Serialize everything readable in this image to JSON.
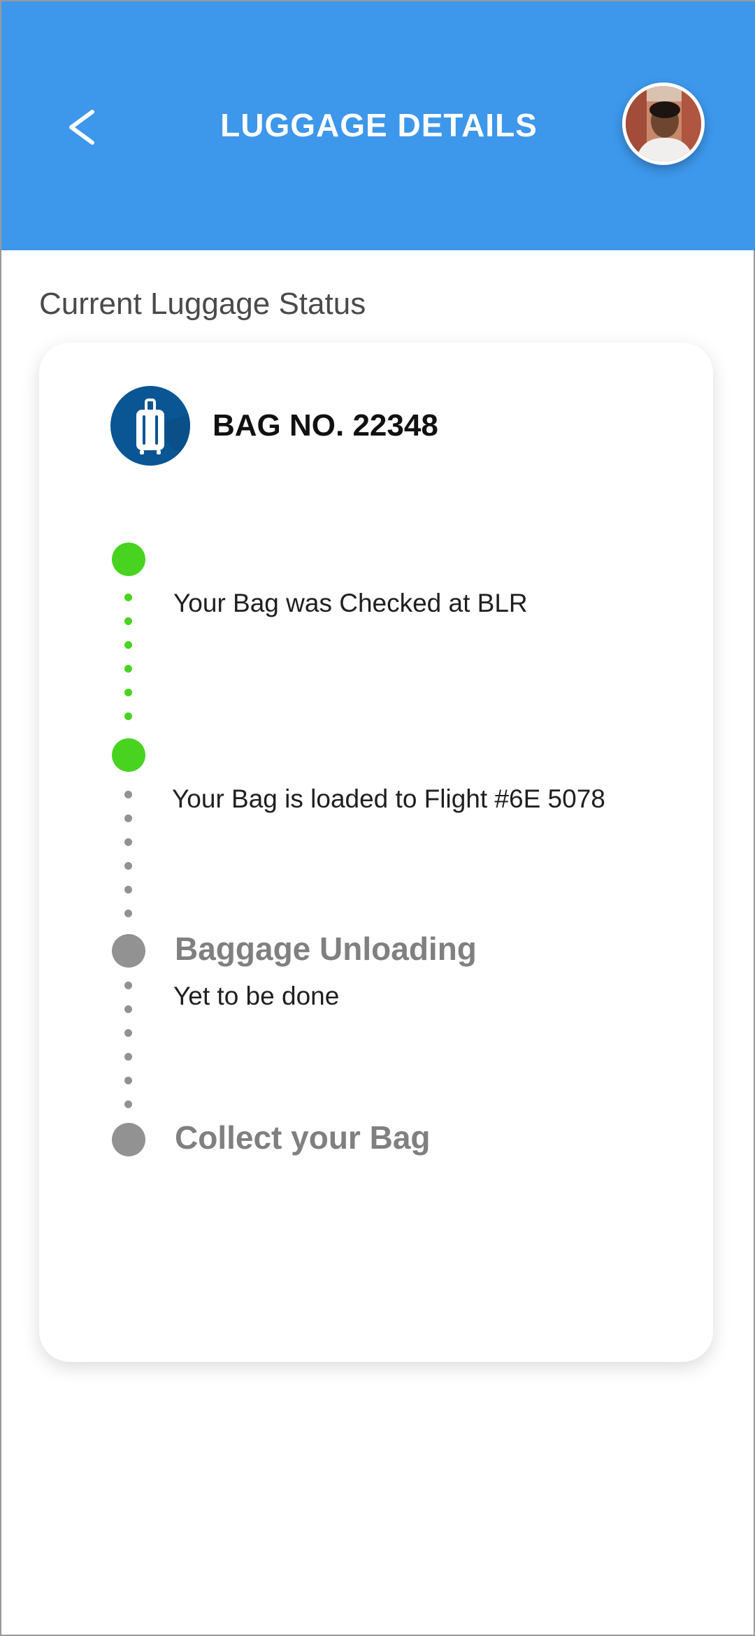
{
  "header": {
    "title": "LUGGAGE DETAILS",
    "background_color": "#3d97ea",
    "back_icon": "chevron-left-icon",
    "avatar": "user-avatar"
  },
  "section": {
    "title": "Current Luggage Status"
  },
  "bag": {
    "icon": "suitcase-icon",
    "title": "BAG NO.  22348"
  },
  "timeline": {
    "steps": [
      {
        "status": "done",
        "color": "#48d321",
        "title": "",
        "text": "Your Bag was Checked at BLR"
      },
      {
        "status": "done",
        "color": "#48d321",
        "title": "",
        "text": "Your Bag is loaded to Flight #6E 5078"
      },
      {
        "status": "pending",
        "color": "#929292",
        "title": "Baggage Unloading",
        "text": "Yet to be done"
      },
      {
        "status": "pending",
        "color": "#929292",
        "title": "Collect your Bag",
        "text": ""
      }
    ]
  }
}
